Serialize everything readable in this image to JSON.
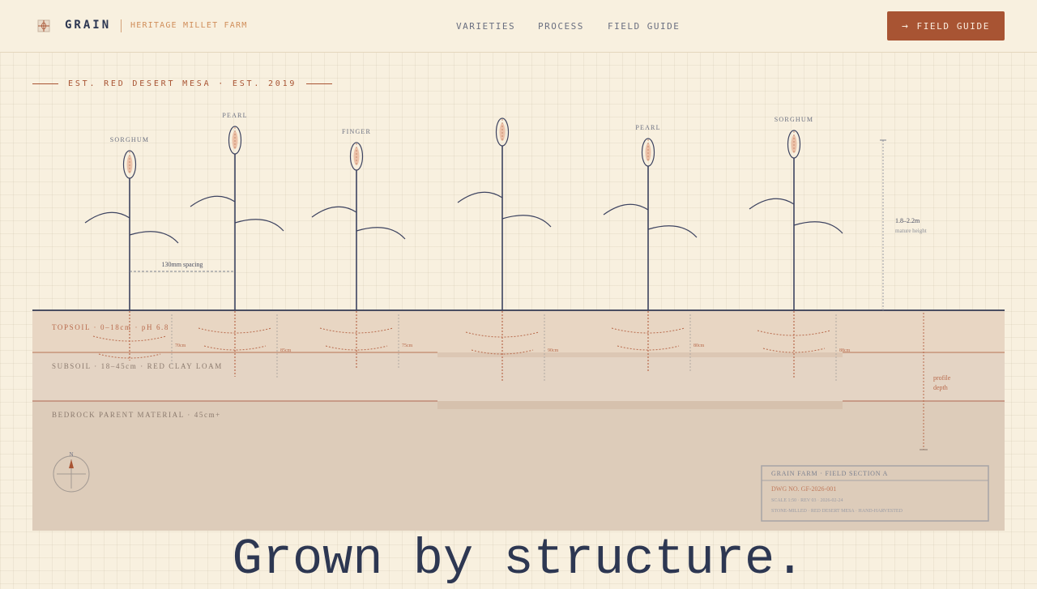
{
  "header": {
    "brand": "GRAIN",
    "tagline": "HERITAGE MILLET FARM",
    "nav": [
      "VARIETIES",
      "PROCESS",
      "FIELD GUIDE"
    ],
    "cta_label": "FIELD GUIDE",
    "logo_icon": "grain-grid-icon",
    "cta_icon": "arrow-right-icon"
  },
  "hero": {
    "established": "EST. RED DESERT MESA · EST. 2019",
    "headline": "Grown by structure."
  },
  "diagram": {
    "plant_labels": [
      "SORGHUM",
      "PEARL",
      "FINGER",
      "",
      "PEARL",
      "SORGHUM"
    ],
    "root_depths": [
      "70cm",
      "85cm",
      "75cm",
      "90cm",
      "80cm",
      "88cm"
    ],
    "spacing_label": "130mm spacing",
    "height_value": "1.8–2.2m",
    "height_label": "mature height",
    "depth_label_1": "profile",
    "depth_label_2": "depth",
    "soil_layers": {
      "topsoil": "TOPSOIL · 0–18cm · pH 6.8",
      "subsoil": "SUBSOIL · 18–45cm · RED CLAY LOAM",
      "bedrock": "BEDROCK PARENT MATERIAL · 45cm+"
    },
    "compass_label": "N",
    "title_block": {
      "title": "GRAIN FARM · FIELD SECTION A",
      "drawing_no": "DWG NO. GF-2026-001",
      "scale": "SCALE 1:50 · REV 03 · 2026-02-24",
      "notes": "STONE-MILLED · RED DESERT MESA · HAND-HARVESTED"
    }
  },
  "colors": {
    "background": "#f8f0df",
    "ink": "#2d3752",
    "accent": "#a85433",
    "soil": "#e5d3c1"
  }
}
